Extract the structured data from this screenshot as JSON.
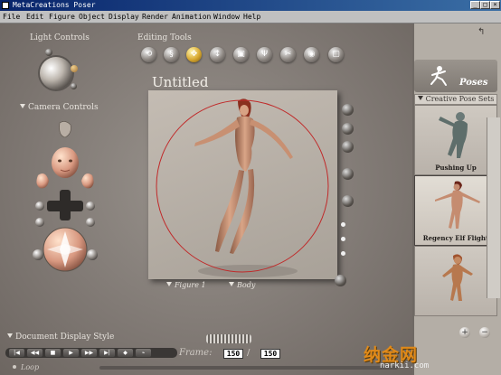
{
  "window": {
    "title": "MetaCreations Poser",
    "controls": [
      "_",
      "□",
      "×"
    ]
  },
  "menubar": [
    "File",
    "Edit",
    "Figure",
    "Object",
    "Display",
    "Render",
    "Animation",
    "Window",
    "Help"
  ],
  "left_panel": {
    "light_controls": "Light Controls",
    "camera_controls": "Camera Controls"
  },
  "toolbar": {
    "label": "Editing Tools",
    "tools": [
      "rotate",
      "twist",
      "translate",
      "translate-in-out",
      "scale",
      "taper",
      "chain-break",
      "color",
      "grouping"
    ],
    "active_tool": "translate"
  },
  "document": {
    "title": "Untitled",
    "figure_menu": "Figure 1",
    "body_menu": "Body"
  },
  "bottom": {
    "document_display_style": "Document Display Style",
    "frame_label": "Frame:",
    "current_frame": "150",
    "total_frames": "150",
    "loop_label": "Loop"
  },
  "right_panel": {
    "library_title": "Poses",
    "category": "Creative Pose Sets",
    "items": [
      {
        "label": "Pushing Up"
      },
      {
        "label": "Regency Elf Flight"
      },
      {
        "label": ""
      }
    ],
    "selected_index": 1
  },
  "watermark": {
    "main": "纳金网",
    "sub": "narkii.com"
  },
  "colors": {
    "title_bar": "#08246b",
    "workspace": "#8a8480",
    "active_tool": "#d8a830",
    "accent_ring": "#c02a2a",
    "watermark": "#e08a1a"
  }
}
